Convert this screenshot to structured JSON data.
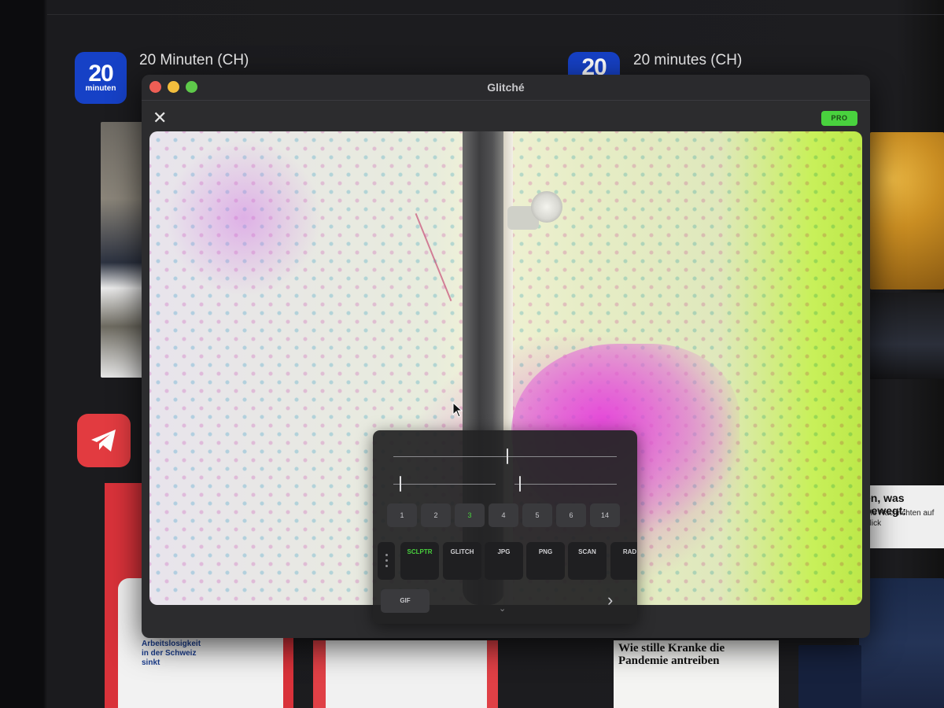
{
  "background": {
    "apps": [
      {
        "name": "20 Minuten (CH)",
        "icon_text": "20",
        "icon_subtext": "minuten"
      },
      {
        "name": "20 minutes (CH)",
        "icon_text": "20"
      }
    ],
    "icons": [
      "telegram-icon"
    ],
    "news": {
      "right_headline": "en, was bewegt:",
      "right_sub": "elle Nachrichten auf",
      "right_sub2": "Blick",
      "bottom_headline": "Wie stille Kranke die Pandemie antreiben",
      "left_thumb_headline": "Arbeitslosigkeit in der Schweiz sinkt"
    }
  },
  "window": {
    "title": "Glitché",
    "close_label": "✕",
    "pro_label": "PRO",
    "colors": {
      "accent": "#49d23e",
      "panel": "#232325"
    }
  },
  "panel": {
    "sliders": [
      {
        "name": "intensity",
        "value": 0.51
      },
      {
        "name": "left-range",
        "value": 0.07
      },
      {
        "name": "right-range",
        "value": 0.05
      }
    ],
    "numbers": [
      "1",
      "2",
      "3",
      "4",
      "5",
      "6",
      "14"
    ],
    "active_number": "3",
    "effects": [
      "SCLPTR",
      "GLITCH",
      "JPG",
      "PNG",
      "SCAN",
      "RAD"
    ],
    "active_effect": "SCLPTR",
    "gif_label": "GIF",
    "next_label": "›",
    "collapse_label": "⌄"
  }
}
